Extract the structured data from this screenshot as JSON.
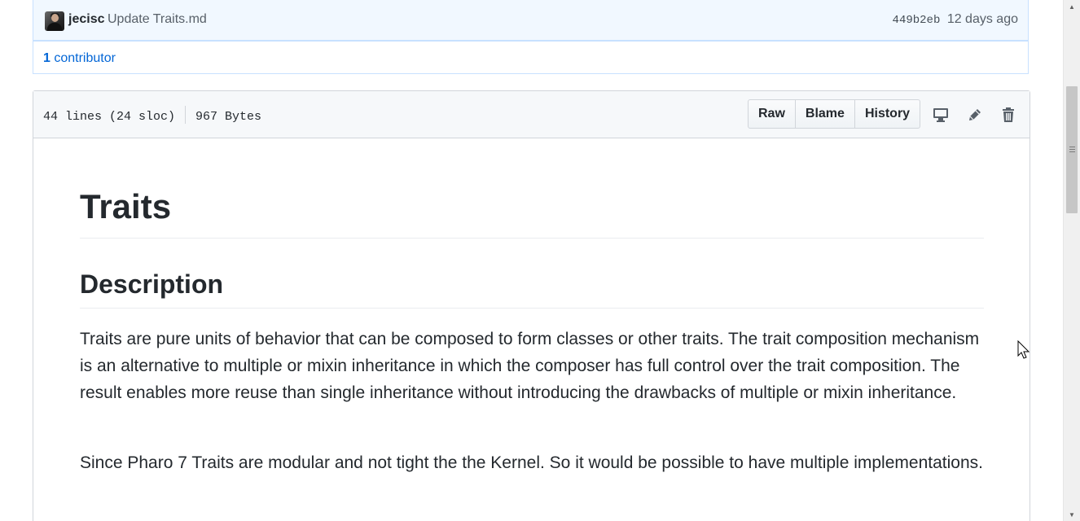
{
  "commit": {
    "author": "jecisc",
    "message": "Update Traits.md",
    "sha": "449b2eb",
    "age": "12 days ago"
  },
  "contributors": {
    "count": "1",
    "label": "contributor"
  },
  "file": {
    "lines": "44 lines (24 sloc)",
    "size": "967 Bytes",
    "buttons": {
      "raw": "Raw",
      "blame": "Blame",
      "history": "History"
    },
    "icons": [
      "desktop-icon",
      "pencil-icon",
      "trash-icon"
    ]
  },
  "readme": {
    "title": "Traits",
    "section_heading": "Description",
    "paragraphs": [
      "Traits are pure units of behavior that can be composed to form classes or other traits. The trait composition mechanism is an alternative to multiple or mixin inheritance in which the composer has full control over the trait composition. The result enables more reuse than single inheritance without introducing the drawbacks of multiple or mixin inheritance.",
      "Since Pharo 7 Traits are modular and not tight the the Kernel. So it would be possible to have multiple implementations."
    ]
  },
  "colors": {
    "link": "#0366d6",
    "commit_bg": "#f1f8ff",
    "commit_border": "#c8e1ff",
    "header_bg": "#f6f8fa"
  }
}
